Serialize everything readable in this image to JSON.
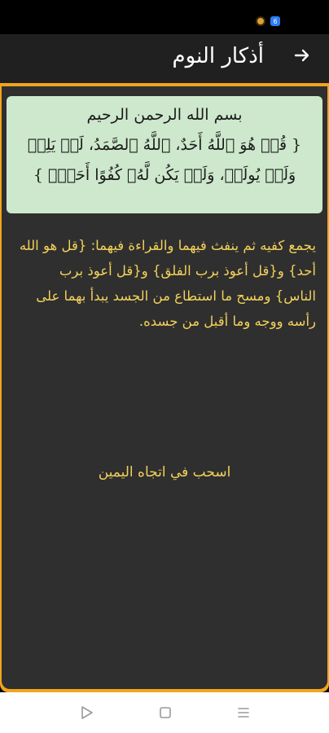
{
  "app_bar": {
    "title": "أذكار النوم",
    "back_icon": "arrow-right-icon"
  },
  "status_bar": {
    "icons": [
      "recording-indicator-icon",
      "notification-badge-icon"
    ]
  },
  "content": {
    "basmala": "بسم الله الرحمن الرحيم",
    "verse": "{ قُلۡ هُوَ ٱللَّهُ أَحَدٌ، ٱللَّهُ ٱلصَّمَدُ، لَمۡ يَلِدۡ وَلَمۡ يُولَدۡ، وَلَمۡ يَكُن لَّهُۥ كُفُوًا أَحَدُۢ }",
    "instruction": "يجمع كفيه ثم ينفث فيهما والقراءة فيهما: {قل هو الله أحد} و{قل أعوذ برب الفلق} و{قل أعوذ برب الناس} ومسح ما استطاع من الجسد يبدأ بهما على رأسه ووجه وما أقبل من جسده.",
    "swipe_hint": "اسحب في اتجاه اليمين"
  },
  "colors": {
    "accent": "#f2a51a",
    "card_bg": "#cde8cc",
    "text_yellow": "#f2d15a",
    "dark_bg": "#2f2f2f"
  },
  "nav_bar": {
    "icons": [
      "back-triangle-icon",
      "home-square-icon",
      "menu-lines-icon"
    ]
  }
}
